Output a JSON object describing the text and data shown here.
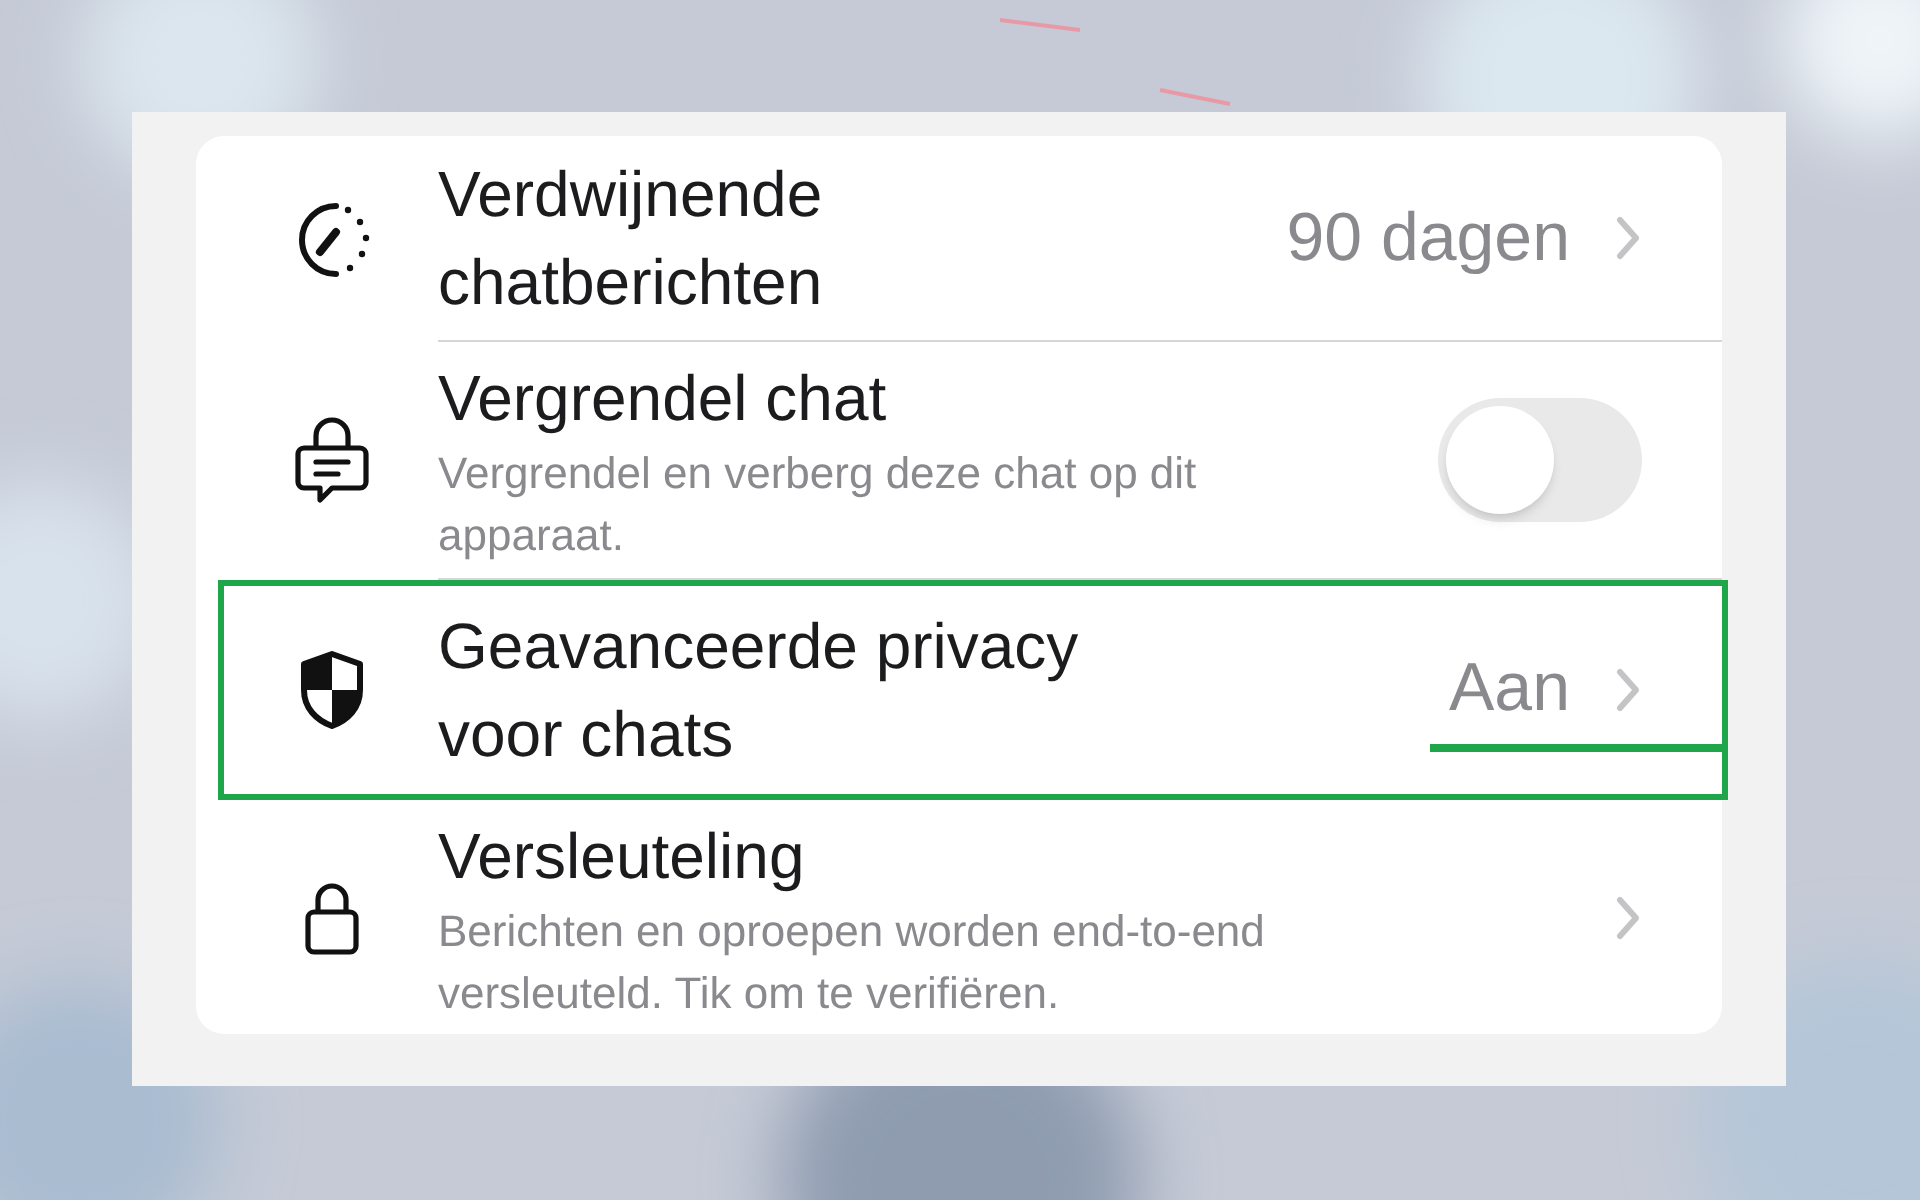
{
  "settings": [
    {
      "kind": "value",
      "title": "Verdwijnende chatberichten",
      "value": "90 dagen",
      "highlighted": false
    },
    {
      "kind": "toggle",
      "title": "Vergrendel chat",
      "subtitle": "Vergrendel en verberg deze chat op dit apparaat.",
      "on": false,
      "highlighted": false
    },
    {
      "kind": "value",
      "title": "Geavanceerde privacy voor chats",
      "value": "Aan",
      "highlighted": true
    },
    {
      "kind": "link",
      "title": "Versleuteling",
      "subtitle": "Berichten en oproepen worden end-to-end versleuteld. Tik om te verifiëren.",
      "highlighted": false
    }
  ]
}
